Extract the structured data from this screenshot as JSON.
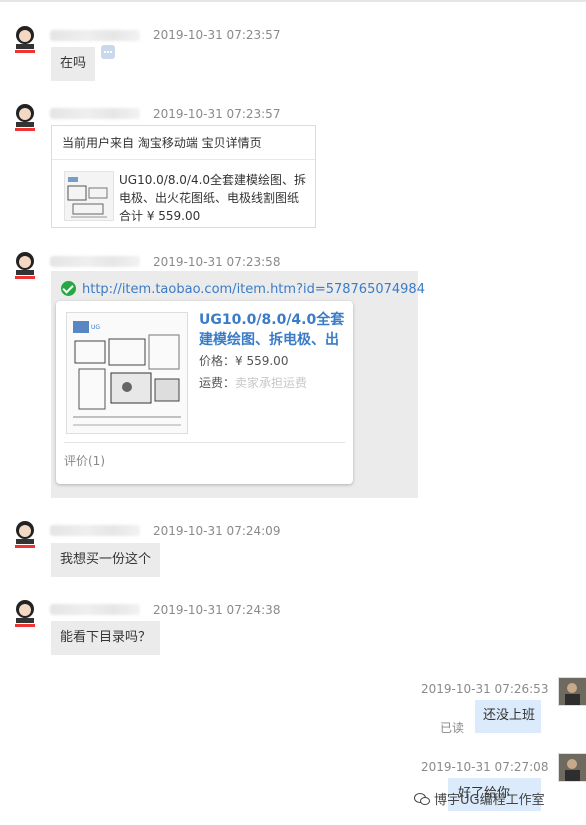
{
  "messages": [
    {
      "timestamp": "2019-10-31 07:23:57",
      "text": "在吗"
    },
    {
      "timestamp": "2019-10-31 07:23:57",
      "card": {
        "header": "当前用户来自 淘宝移动端 宝贝详情页",
        "desc": "UG10.0/8.0/4.0全套建模绘图、拆电极、出火花图纸、电极线割图纸",
        "total": "合计 ¥ 559.00"
      }
    },
    {
      "timestamp": "2019-10-31 07:23:58",
      "link": {
        "url": "http://item.taobao.com/item.htm?id=578765074984",
        "title": "UG10.0/8.0/4.0全套建模绘图、拆电极、出",
        "price_label": "价格：",
        "price": "¥ 559.00",
        "ship_label": "运费：",
        "ship_value": "卖家承担运费",
        "review": "评价(1)"
      }
    },
    {
      "timestamp": "2019-10-31 07:24:09",
      "text": "我想买一份这个"
    },
    {
      "timestamp": "2019-10-31 07:24:38",
      "text": "能看下目录吗？"
    },
    {
      "timestamp": "2019-10-31 07:26:53",
      "text": "还没上班",
      "read": "已读"
    },
    {
      "timestamp": "2019-10-31 07:27:08",
      "text": "好了给你"
    }
  ],
  "watermark": "博宇UG编程工作室",
  "colors": {
    "bubble_in": "#ebebeb",
    "bubble_out": "#dcebfb",
    "link": "#3a7cc7",
    "check": "#27a844"
  },
  "icons": {
    "customer_avatar": "cartoon-avatar-icon",
    "agent_avatar": "photo-avatar-icon",
    "verified": "check-circle-icon"
  }
}
